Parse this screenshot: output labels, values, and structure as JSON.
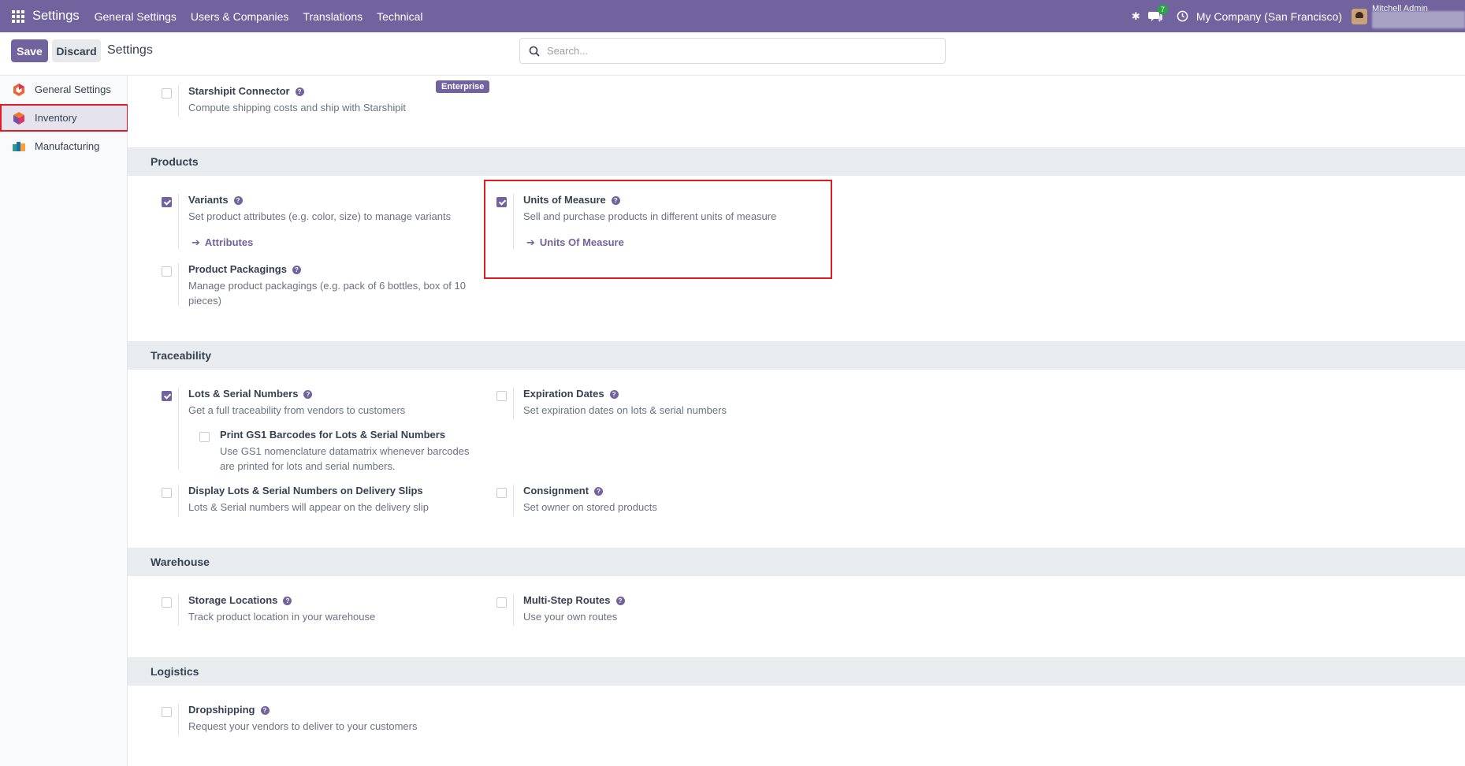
{
  "navbar": {
    "app_title": "Settings",
    "menu": [
      "General Settings",
      "Users & Companies",
      "Translations",
      "Technical"
    ],
    "chat_count": "7",
    "company": "My Company (San Francisco)",
    "user_name": "Mitchell Admin"
  },
  "control": {
    "save_label": "Save",
    "discard_label": "Discard",
    "breadcrumb": "Settings",
    "search_placeholder": "Search..."
  },
  "sidebar": {
    "items": [
      {
        "label": "General Settings",
        "icon": "general-settings-icon"
      },
      {
        "label": "Inventory",
        "icon": "inventory-icon",
        "active": true
      },
      {
        "label": "Manufacturing",
        "icon": "manufacturing-icon"
      }
    ]
  },
  "top_setting": {
    "title": "Starshipit Connector",
    "desc": "Compute shipping costs and ship with Starshipit",
    "badge": "Enterprise",
    "checked": false
  },
  "sections": {
    "products": {
      "title": "Products",
      "variants": {
        "title": "Variants",
        "desc": "Set product attributes (e.g. color, size) to manage variants",
        "link": "Attributes",
        "checked": true
      },
      "uom": {
        "title": "Units of Measure",
        "desc": "Sell and purchase products in different units of measure",
        "link": "Units Of Measure",
        "checked": true
      },
      "packagings": {
        "title": "Product Packagings",
        "desc": "Manage product packagings (e.g. pack of 6 bottles, box of 10 pieces)",
        "checked": false
      }
    },
    "traceability": {
      "title": "Traceability",
      "lots": {
        "title": "Lots & Serial Numbers",
        "desc": "Get a full traceability from vendors to customers",
        "checked": true
      },
      "gs1": {
        "title": "Print GS1 Barcodes for Lots & Serial Numbers",
        "desc": "Use GS1 nomenclature datamatrix whenever barcodes are printed for lots and serial numbers.",
        "checked": false
      },
      "expiration": {
        "title": "Expiration Dates",
        "desc": "Set expiration dates on lots & serial numbers",
        "checked": false
      },
      "display_lots": {
        "title": "Display Lots & Serial Numbers on Delivery Slips",
        "desc": "Lots & Serial numbers will appear on the delivery slip",
        "checked": false
      },
      "consignment": {
        "title": "Consignment",
        "desc": "Set owner on stored products",
        "checked": false
      }
    },
    "warehouse": {
      "title": "Warehouse",
      "storage": {
        "title": "Storage Locations",
        "desc": "Track product location in your warehouse",
        "checked": false
      },
      "multistep": {
        "title": "Multi-Step Routes",
        "desc": "Use your own routes",
        "checked": false
      }
    },
    "logistics": {
      "title": "Logistics",
      "dropshipping": {
        "title": "Dropshipping",
        "desc": "Request your vendors to deliver to your customers",
        "checked": false
      }
    }
  },
  "colors": {
    "brand": "#71639e",
    "highlight": "#e01b24",
    "badge_green": "#28a745"
  }
}
